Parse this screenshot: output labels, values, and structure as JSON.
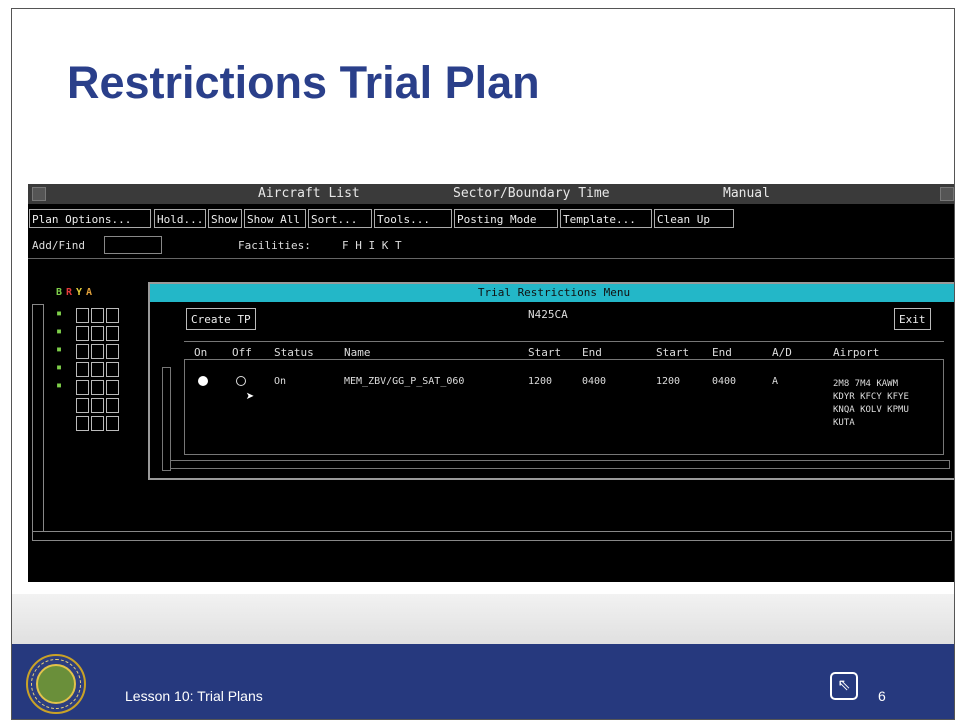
{
  "slide": {
    "title": "Restrictions Trial Plan",
    "footer_text": "Lesson 10: Trial Plans",
    "page_number": "6",
    "seal_icon": "faa-seal-icon",
    "cursor_icon": "cursor-click-icon"
  },
  "app": {
    "titlebar": {
      "list_title": "Aircraft List",
      "sort_label": "Sector/Boundary Time",
      "mode": "Manual"
    },
    "menu": [
      "Plan Options...",
      "Hold...",
      "Show",
      "Show All",
      "Sort...",
      "Tools...",
      "Posting Mode",
      "Template...",
      "Clean Up"
    ],
    "addfind_label": "Add/Find",
    "facilities_label": "Facilities:",
    "facilities_value": "F H I K T",
    "status_flags": [
      "B",
      "R",
      "Y",
      "A"
    ]
  },
  "dialog": {
    "title": "Trial Restrictions Menu",
    "create_button": "Create TP",
    "exit_button": "Exit",
    "callsign": "N425CA",
    "columns": [
      "On",
      "Off",
      "Status",
      "Name",
      "Start",
      "End",
      "Start",
      "End",
      "A/D",
      "Airport"
    ],
    "row": {
      "status": "On",
      "name": "MEM_ZBV/GG_P_SAT_060",
      "start1": "1200",
      "end1": "0400",
      "start2": "1200",
      "end2": "0400",
      "ad": "A",
      "airports": "2M8 7M4 KAWM\nKDYR KFCY KFYE\nKNQA KOLV KPMU\nKUTA"
    }
  },
  "colors": {
    "title_blue": "#2a3f8a",
    "footer_blue": "#26397e",
    "dialog_titlebar": "#23b7c8"
  }
}
